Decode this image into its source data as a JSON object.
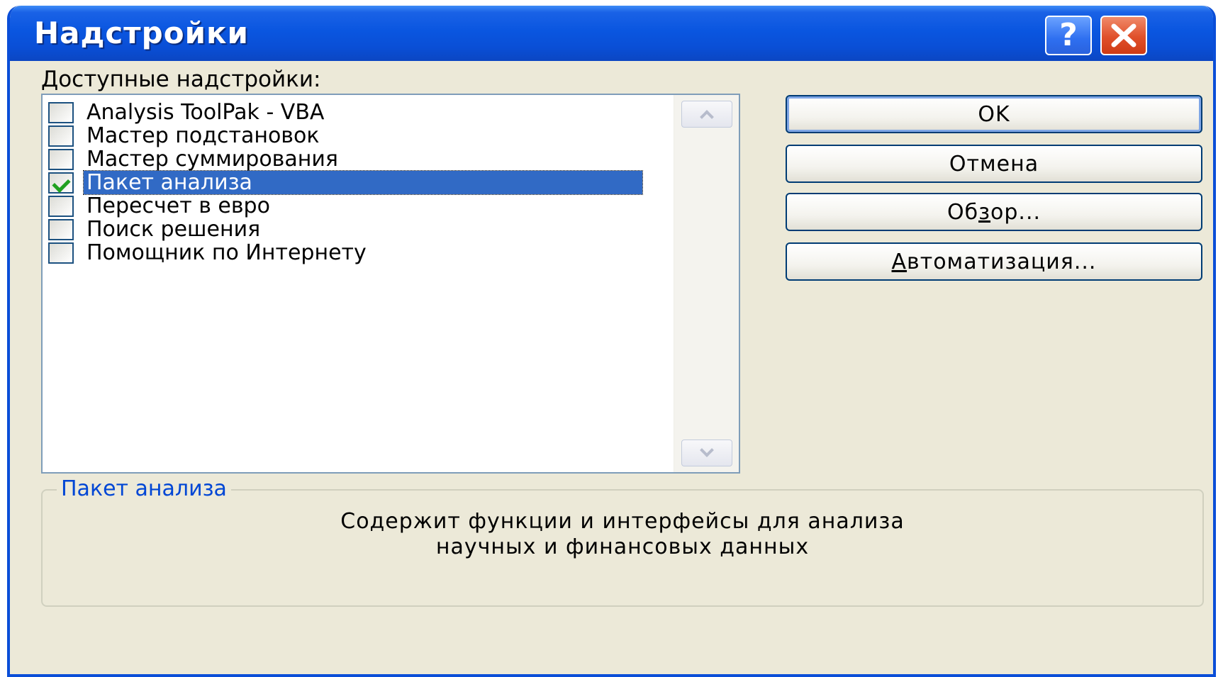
{
  "window": {
    "title": "Надстройки",
    "help_glyph": "?",
    "close_icon": "close-icon"
  },
  "list": {
    "label_accel": "Д",
    "label_rest": "оступные надстройки:",
    "items": [
      {
        "label": "Analysis ToolPak - VBA",
        "checked": false,
        "selected": false
      },
      {
        "label": "Мастер подстановок",
        "checked": false,
        "selected": false
      },
      {
        "label": "Мастер суммирования",
        "checked": false,
        "selected": false
      },
      {
        "label": "Пакет анализа",
        "checked": true,
        "selected": true
      },
      {
        "label": "Пересчет в евро",
        "checked": false,
        "selected": false
      },
      {
        "label": "Поиск решения",
        "checked": false,
        "selected": false
      },
      {
        "label": "Помощник по Интернету",
        "checked": false,
        "selected": false
      }
    ]
  },
  "buttons": {
    "ok": "OK",
    "cancel": "Отмена",
    "browse_pre": "Об",
    "browse_accel": "з",
    "browse_post": "ор...",
    "auto_accel": "А",
    "auto_rest": "втоматизация..."
  },
  "description": {
    "title": "Пакет анализа",
    "line1": "Содержит функции и интерфейсы для анализа",
    "line2": "научных и финансовых данных"
  },
  "colors": {
    "titlebar": "#0a56e0",
    "selection": "#316ac5",
    "dialog_bg": "#ece9d8",
    "legend_text": "#0046d5",
    "check_mark": "#21a121"
  }
}
